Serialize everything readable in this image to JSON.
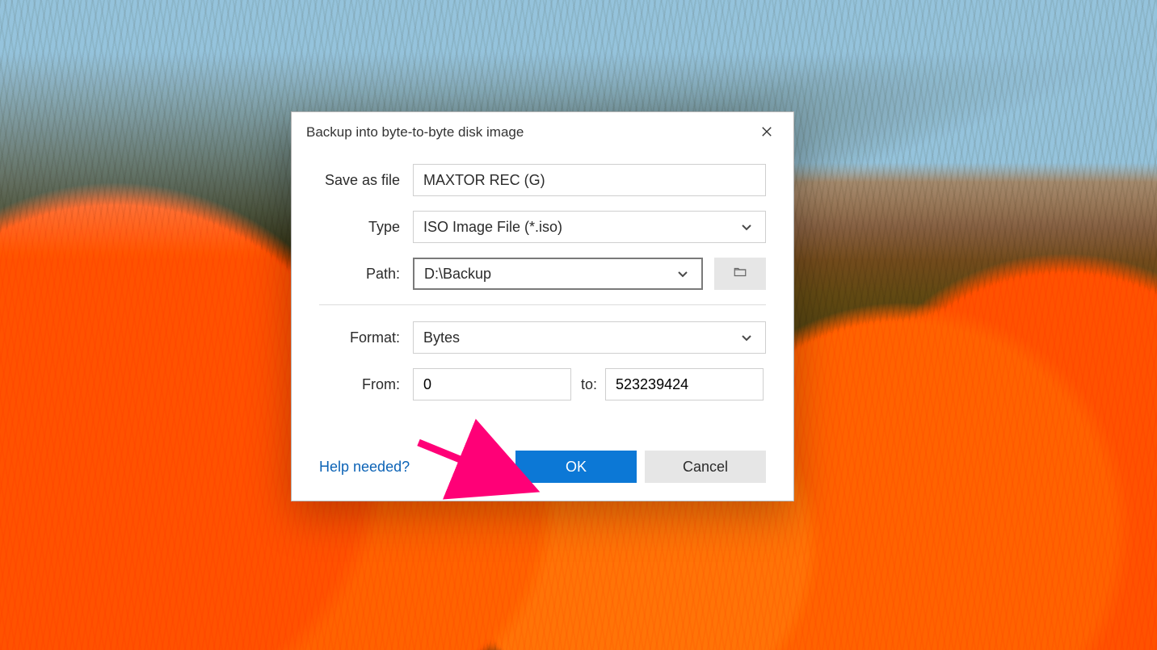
{
  "dialog": {
    "title": "Backup into byte-to-byte disk image",
    "labels": {
      "save_as_file": "Save as file",
      "type": "Type",
      "path": "Path:",
      "format": "Format:",
      "from": "From:",
      "to": "to:"
    },
    "fields": {
      "save_as_file_value": "MAXTOR REC (G)",
      "type_value": "ISO Image File (*.iso)",
      "path_value": "D:\\Backup",
      "format_value": "Bytes",
      "from_value": "0",
      "to_value": "523239424"
    },
    "buttons": {
      "ok": "OK",
      "cancel": "Cancel",
      "help": "Help needed?"
    }
  },
  "annotation": {
    "arrow_color": "#ff0077"
  },
  "icons": {
    "close": "close-icon",
    "chevron_down": "chevron-down-icon",
    "folder": "folder-icon"
  }
}
